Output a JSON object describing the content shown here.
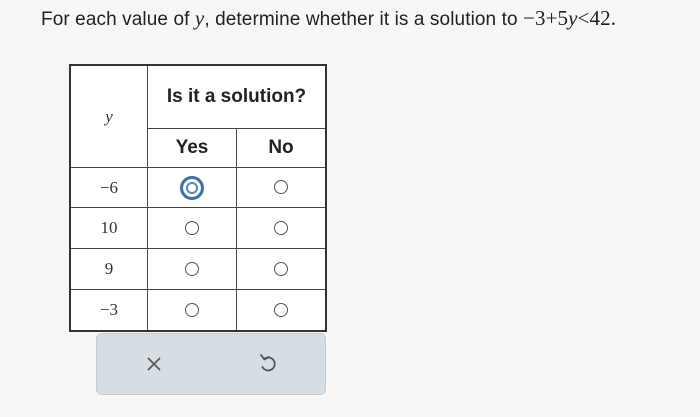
{
  "prompt": {
    "lead": "For each value of ",
    "var": "y",
    "middle": ", determine whether it is a solution to ",
    "inequality": {
      "part1": "−3+5",
      "var": "y",
      "part2": "<42",
      "end": "."
    }
  },
  "table": {
    "col_var": "y",
    "header": "Is it a solution?",
    "col_yes": "Yes",
    "col_no": "No",
    "rows": [
      {
        "y": "−6",
        "selected": "yes"
      },
      {
        "y": "10",
        "selected": null
      },
      {
        "y": "9",
        "selected": null
      },
      {
        "y": "−3",
        "selected": null
      }
    ]
  },
  "actions": {
    "clear_icon": "x-icon",
    "undo_icon": "undo-icon"
  },
  "colors": {
    "selected_radio": "#3a6fb0",
    "action_bar": "#d6dde3"
  }
}
